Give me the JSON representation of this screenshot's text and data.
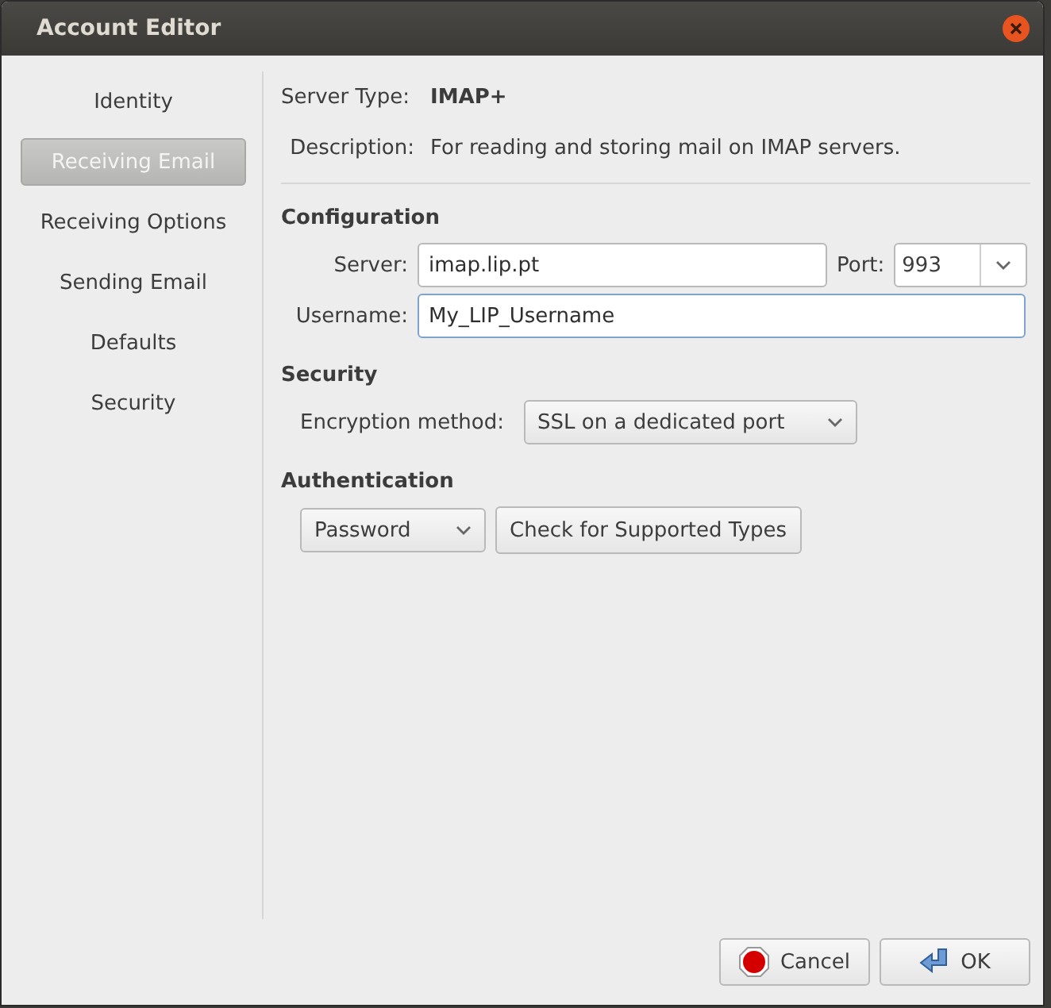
{
  "window": {
    "title": "Account Editor"
  },
  "sidebar": {
    "items": [
      {
        "label": "Identity",
        "selected": false
      },
      {
        "label": "Receiving Email",
        "selected": true
      },
      {
        "label": "Receiving Options",
        "selected": false
      },
      {
        "label": "Sending Email",
        "selected": false
      },
      {
        "label": "Defaults",
        "selected": false
      },
      {
        "label": "Security",
        "selected": false
      }
    ]
  },
  "info": [
    {
      "label": "Server Type:",
      "value": "IMAP+",
      "bold": true
    },
    {
      "label": "Description:",
      "value": "For reading and storing mail on IMAP servers.",
      "bold": false
    }
  ],
  "configuration": {
    "heading": "Configuration",
    "server": {
      "label": "Server:",
      "value": "imap.lip.pt",
      "focused": false
    },
    "port": {
      "label": "Port:",
      "value": "993"
    },
    "username": {
      "label": "Username:",
      "value": "My_LIP_Username",
      "focused": true
    }
  },
  "security": {
    "heading": "Security",
    "encryption": {
      "label": "Encryption method:",
      "value": "SSL on a dedicated port"
    }
  },
  "authentication": {
    "heading": "Authentication",
    "method": "Password",
    "check_button": "Check for Supported Types"
  },
  "buttons": [
    {
      "label": "Cancel",
      "kind": "cancel"
    },
    {
      "label": "OK",
      "kind": "ok"
    }
  ]
}
